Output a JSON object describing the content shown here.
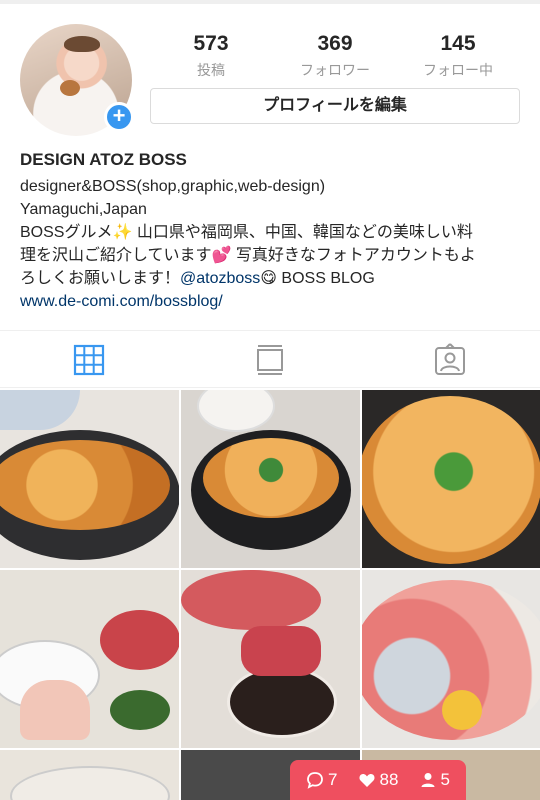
{
  "profile": {
    "stats": [
      {
        "value": "573",
        "label": "投稿"
      },
      {
        "value": "369",
        "label": "フォロワー"
      },
      {
        "value": "145",
        "label": "フォロー中"
      }
    ],
    "edit_button": "プロフィールを編集",
    "name": "DESIGN ATOZ BOSS",
    "bio_line1": "designer&BOSS(shop,graphic,web-design)",
    "bio_line2": "Yamaguchi,Japan",
    "bio_line3": "BOSSグルメ✨ 山口県や福岡県、中国、韓国などの美味しい料",
    "bio_line4": "理を沢山ご紹介しています💕 写真好きなフォトアカウントもよ",
    "bio_line5_a": "ろしくお願いします！",
    "bio_mention": "@atozboss",
    "bio_line5_b": "😋 BOSS BLOG",
    "link": "www.de-comi.com/bossblog/"
  },
  "tabs": [
    {
      "icon": "grid-icon",
      "active": true
    },
    {
      "icon": "list-icon",
      "active": false
    },
    {
      "icon": "tagged-icon",
      "active": false
    }
  ],
  "notification": {
    "comments": "7",
    "likes": "88",
    "followers": "5"
  },
  "colors": {
    "accent": "#3897f0",
    "link": "#003569",
    "notification": "#ef4f5f",
    "muted": "#999999"
  }
}
